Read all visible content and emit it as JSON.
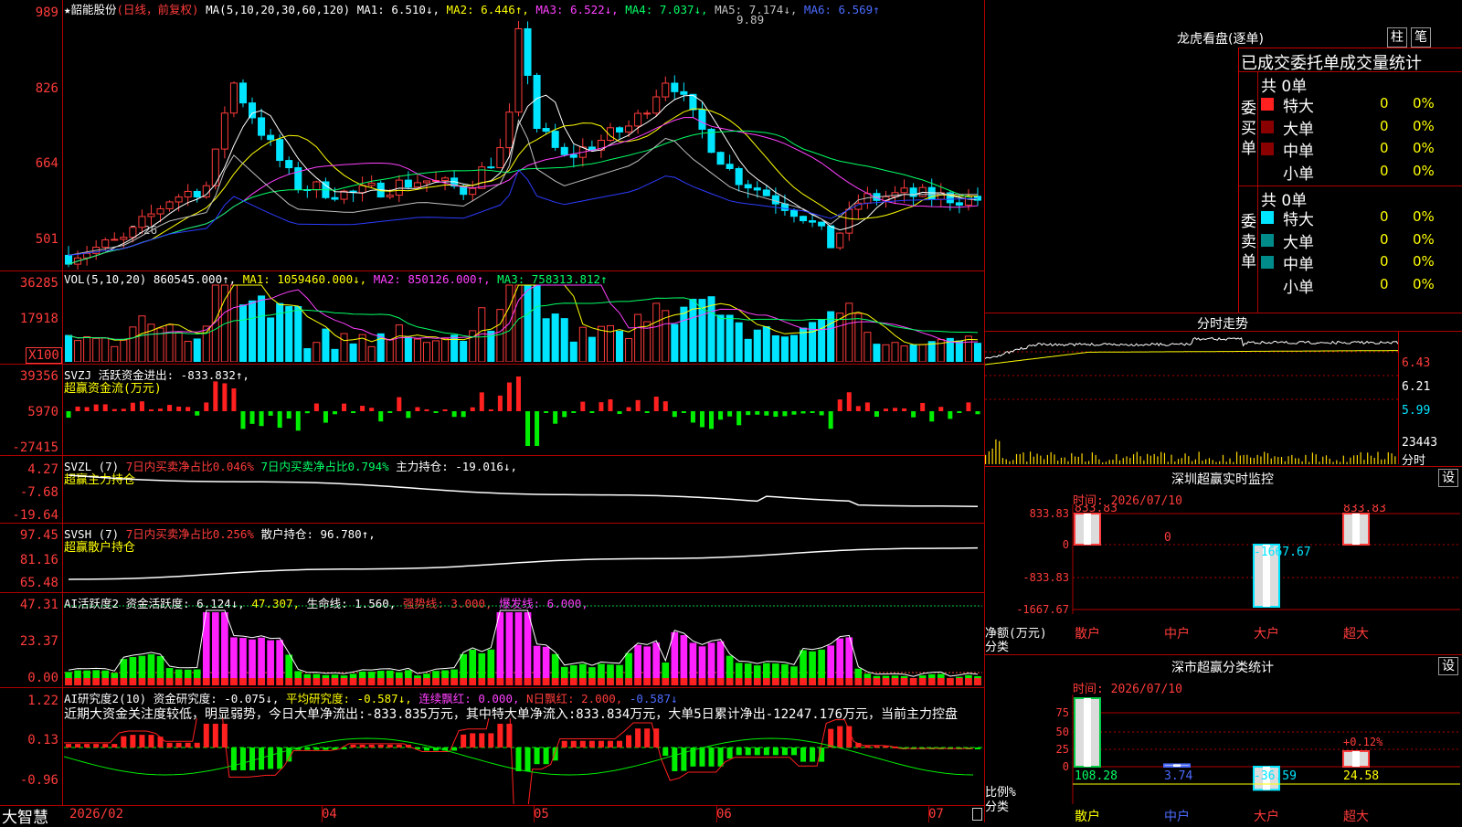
{
  "app": {
    "name": "大智慧"
  },
  "main": {
    "kline": {
      "header": {
        "stock": "★韶能股份",
        "mode": "(日线，前复权)",
        "ma_def": "MA(5,10,20,30,60,120)",
        "ma1": "MA1: 6.510↓,",
        "ma2": "MA2: 6.446↑,",
        "ma3": "MA3: 6.522↓,",
        "ma4": "MA4: 7.037↓,",
        "ma5": "MA5: 7.174↓,",
        "ma6": "MA6: 6.569↑"
      },
      "y_labels": [
        "989",
        "826",
        "664",
        "501"
      ],
      "annot_high": "9.89",
      "annot_low": "5.26"
    },
    "vol": {
      "header": {
        "def": "VOL(5,10,20)",
        "v": "860545.000↑,",
        "ma1": "MA1: 1059460.000↓,",
        "ma2": "MA2: 850126.000↑,",
        "ma3": "MA3: 758313.812↑"
      },
      "y_labels": [
        "36285",
        "17918"
      ],
      "unit": "X100"
    },
    "svzj": {
      "header": {
        "a": "SVZJ  活跃资金进出: -833.832↑,",
        "b": "超赢资金流(万元)"
      },
      "y_labels": [
        "39356",
        "5970",
        "-27415"
      ]
    },
    "svzl": {
      "header": {
        "a": "SVZL (7)",
        "b": "7日内买卖净占比0.046%",
        "c": "7日内买卖净占比0.794%",
        "d": "主力持仓: -19.016↓,",
        "e": "超赢主力持仓"
      },
      "y_labels": [
        "4.27",
        "-7.68",
        "-19.64"
      ]
    },
    "svsh": {
      "header": {
        "a": "SVSH (7)",
        "b": "7日内买卖净占比0.256%",
        "c": "散户持仓: 96.780↑,",
        "d": "超赢散户持仓"
      },
      "y_labels": [
        "97.45",
        "81.16",
        "65.48"
      ]
    },
    "ai_active": {
      "header": {
        "a": "AI活跃度2 资金活跃度: 6.124↓,",
        "b": "47.307,",
        "c": "生命线: 1.560,",
        "d": "强势线: 3.000,",
        "e": "爆发线: 6.000,"
      },
      "y_labels": [
        "47.31",
        "23.37",
        "0.00"
      ]
    },
    "ai_research": {
      "header": {
        "a": "AI研究度2(10) 资金研究度: -0.075↓,",
        "b": "平均研究度: -0.587↓,",
        "c": "连续飘红: 0.000,",
        "d": "N日飘红: 2.000,",
        "e": "-0.587↓"
      },
      "comment": "近期大资金关注度较低，明显弱势，今日大单净流出:-833.835万元，其中特大单净流入:833.834万元，大单5日累计净出-12247.176万元，当前主力控盘",
      "y_labels": [
        "1.22",
        "0.13",
        "-0.96"
      ]
    },
    "x_axis": [
      "2026/02",
      "04",
      "05",
      "06",
      "07"
    ]
  },
  "right": {
    "lhb": {
      "title": "龙虎看盘(逐单)",
      "btn1": "柱",
      "btn2": "笔",
      "subtitle": "已成交委托单成交量统计",
      "buy": {
        "side_label": "委买单",
        "total": "共 0单",
        "rows": [
          {
            "name": "特大",
            "count": "0",
            "pct": "0%"
          },
          {
            "name": "大单",
            "count": "0",
            "pct": "0%"
          },
          {
            "name": "中单",
            "count": "0",
            "pct": "0%"
          },
          {
            "name": "小单",
            "count": "0",
            "pct": "0%"
          }
        ]
      },
      "sell": {
        "side_label": "委卖单",
        "total": "共 0单",
        "rows": [
          {
            "name": "特大",
            "count": "0",
            "pct": "0%"
          },
          {
            "name": "大单",
            "count": "0",
            "pct": "0%"
          },
          {
            "name": "中单",
            "count": "0",
            "pct": "0%"
          },
          {
            "name": "小单",
            "count": "0",
            "pct": "0%"
          }
        ]
      }
    },
    "intraday": {
      "title": "分时走势",
      "y_labels": [
        "6.43",
        "6.21",
        "5.99"
      ],
      "vol_label": "23443",
      "vol_unit": "分时"
    },
    "monitor": {
      "title": "深圳超赢实时监控",
      "btn": "设",
      "time": "时间: 2026/07/10",
      "y_labels": [
        "833.83",
        "0",
        "-833.83",
        "-1667.67"
      ],
      "unit": "净额(万元)",
      "cat_label": "分类",
      "bars": [
        {
          "cat": "散户",
          "value": "833.83"
        },
        {
          "cat": "中户",
          "value": "0"
        },
        {
          "cat": "大户",
          "value": "-1667.67"
        },
        {
          "cat": "超大",
          "value": "833.83"
        }
      ]
    },
    "stat": {
      "title": "深市超赢分类统计",
      "btn": "设",
      "time": "时间: 2026/07/10",
      "y_labels": [
        "75",
        "50",
        "25",
        "0"
      ],
      "unit": "比例%",
      "cat_label": "分类",
      "extra": "+0.12%",
      "bars": [
        {
          "cat": "散户",
          "value": "108.28"
        },
        {
          "cat": "中户",
          "value": "3.74"
        },
        {
          "cat": "大户",
          "value": "-36.59"
        },
        {
          "cat": "超大",
          "value": "24.58"
        }
      ]
    }
  }
}
